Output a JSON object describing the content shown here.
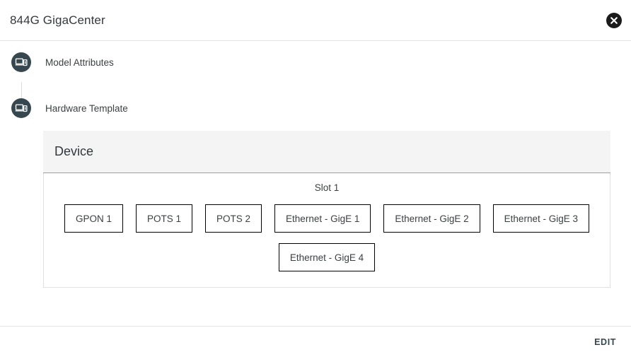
{
  "titlebar": {
    "title": "844G GigaCenter",
    "close_icon": "close-circle-icon"
  },
  "stepper": {
    "steps": [
      {
        "label": "Model Attributes",
        "icon": "devices-icon"
      },
      {
        "label": "Hardware Template",
        "icon": "devices-icon"
      }
    ]
  },
  "device_card": {
    "header_title": "Device",
    "slot": {
      "title": "Slot 1",
      "rows": [
        [
          {
            "label": "GPON 1"
          },
          {
            "label": "POTS 1"
          },
          {
            "label": "POTS 2"
          },
          {
            "label": "Ethernet - GigE 1"
          },
          {
            "label": "Ethernet - GigE 2"
          },
          {
            "label": "Ethernet - GigE 3"
          }
        ],
        [
          {
            "label": "Ethernet - GigE 4"
          }
        ]
      ]
    }
  },
  "footer": {
    "edit_label": "EDIT"
  },
  "colors": {
    "step_icon_bg": "#37474f",
    "header_bg": "#f4f4f4",
    "edit_text": "#37474f",
    "close_bg": "#1b1b1b"
  }
}
